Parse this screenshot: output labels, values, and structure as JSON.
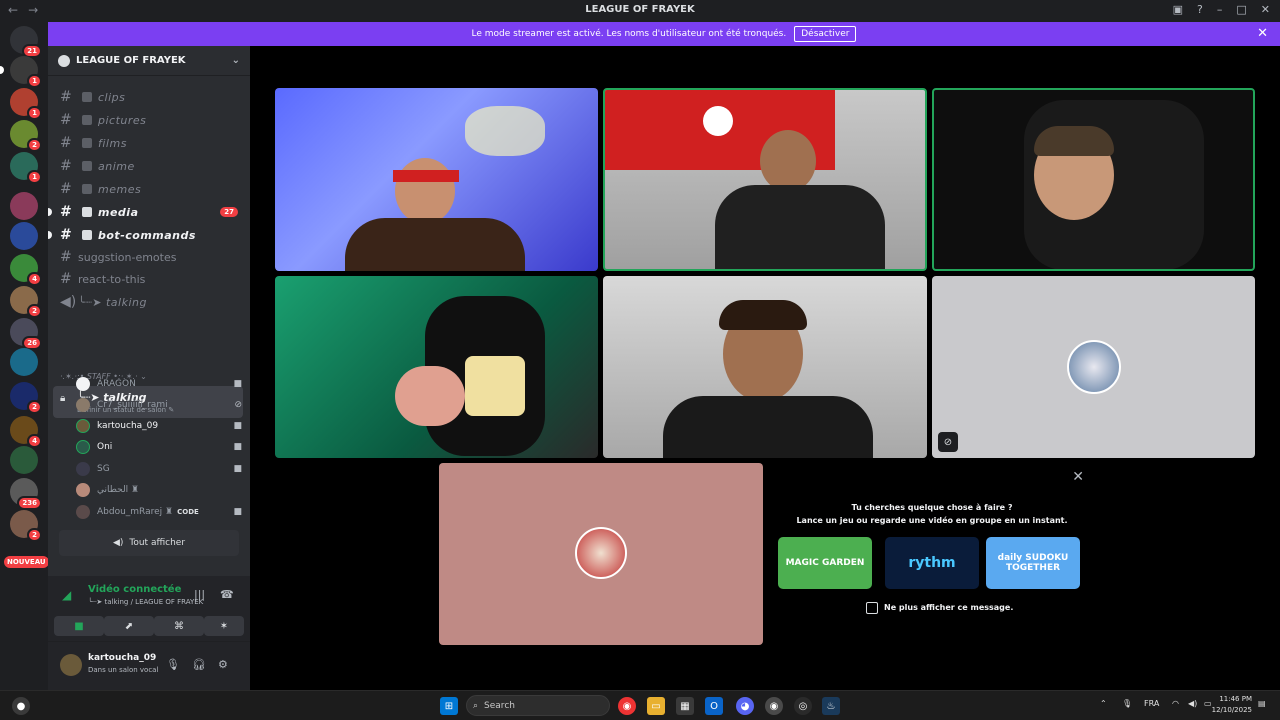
{
  "window": {
    "title": "LEAGUE OF FRAYEK"
  },
  "banner": {
    "text": "Le mode streamer est activé. Les noms d'utilisateur ont été tronqués.",
    "button": "Désactiver",
    "bg_color": "#7b3ff2"
  },
  "rail": {
    "badges": [
      "21",
      "1",
      "1",
      "2",
      "1",
      "4",
      "2",
      "26",
      "2",
      "4",
      "236",
      "2"
    ],
    "new_label": "NOUVEAU"
  },
  "guild": {
    "name": "LEAGUE OF FRAYEK"
  },
  "channels": [
    {
      "name": "clips",
      "style": "muted"
    },
    {
      "name": "pictures",
      "style": "muted"
    },
    {
      "name": "films",
      "style": "muted"
    },
    {
      "name": "anime",
      "style": "muted"
    },
    {
      "name": "memes",
      "style": "muted"
    },
    {
      "name": "media",
      "style": "bold",
      "badge": "27"
    },
    {
      "name": "bot-commands",
      "style": "bold"
    },
    {
      "name": "suggstion-emotes",
      "style": "plain"
    },
    {
      "name": "react-to-this",
      "style": "plain"
    },
    {
      "name": "╰┈➤ talking",
      "style": "voice"
    }
  ],
  "category": "·.✶.·:• STAFF •:·.✶.· ⌄",
  "active_channel": {
    "name": "╰┈➤ talking",
    "status": "Définir un statut de salon ✎"
  },
  "voice_users": [
    {
      "name": "ARAGON",
      "live": false,
      "icon": "camera-icon"
    },
    {
      "name": "Cr7_suiiiiii_rami",
      "live": false,
      "icon": "mic-muted-icon"
    },
    {
      "name": "kartoucha_09",
      "live": true,
      "icon": "camera-icon"
    },
    {
      "name": "Oni",
      "live": true,
      "icon": "camera-icon"
    },
    {
      "name": "SG",
      "live": false,
      "icon": "camera-icon"
    },
    {
      "name": "الحطاني ♜",
      "live": false,
      "icon": "none"
    },
    {
      "name": "Abdou_mRarej ♜",
      "live": false,
      "icon": "camera-icon",
      "tag": "CODE"
    }
  ],
  "show_all": "Tout afficher",
  "voice_panel": {
    "status": "Vidéo connectée",
    "location": "╰┈➤ talking / LEAGUE OF FRAYEK",
    "status_color": "#23a55a"
  },
  "user_panel": {
    "username": "kartoucha_09",
    "status": "Dans un salon vocal"
  },
  "activity": {
    "line1": "Tu cherches quelque chose à faire ?",
    "line2": "Lance un jeu ou regarde une vidéo en groupe en un instant.",
    "cards": [
      {
        "label": "MAGIC GARDEN",
        "color": "#4caf50"
      },
      {
        "label": "rythm",
        "color": "#0a1c3a"
      },
      {
        "label": "daily SUDOKU TOGETHER",
        "color": "#5aa9f0"
      }
    ],
    "checkbox_label": "Ne plus afficher ce message."
  },
  "taskbar": {
    "search_placeholder": "Search",
    "lang": "FRA",
    "time": "11:46 PM",
    "date": "12/10/2025"
  }
}
